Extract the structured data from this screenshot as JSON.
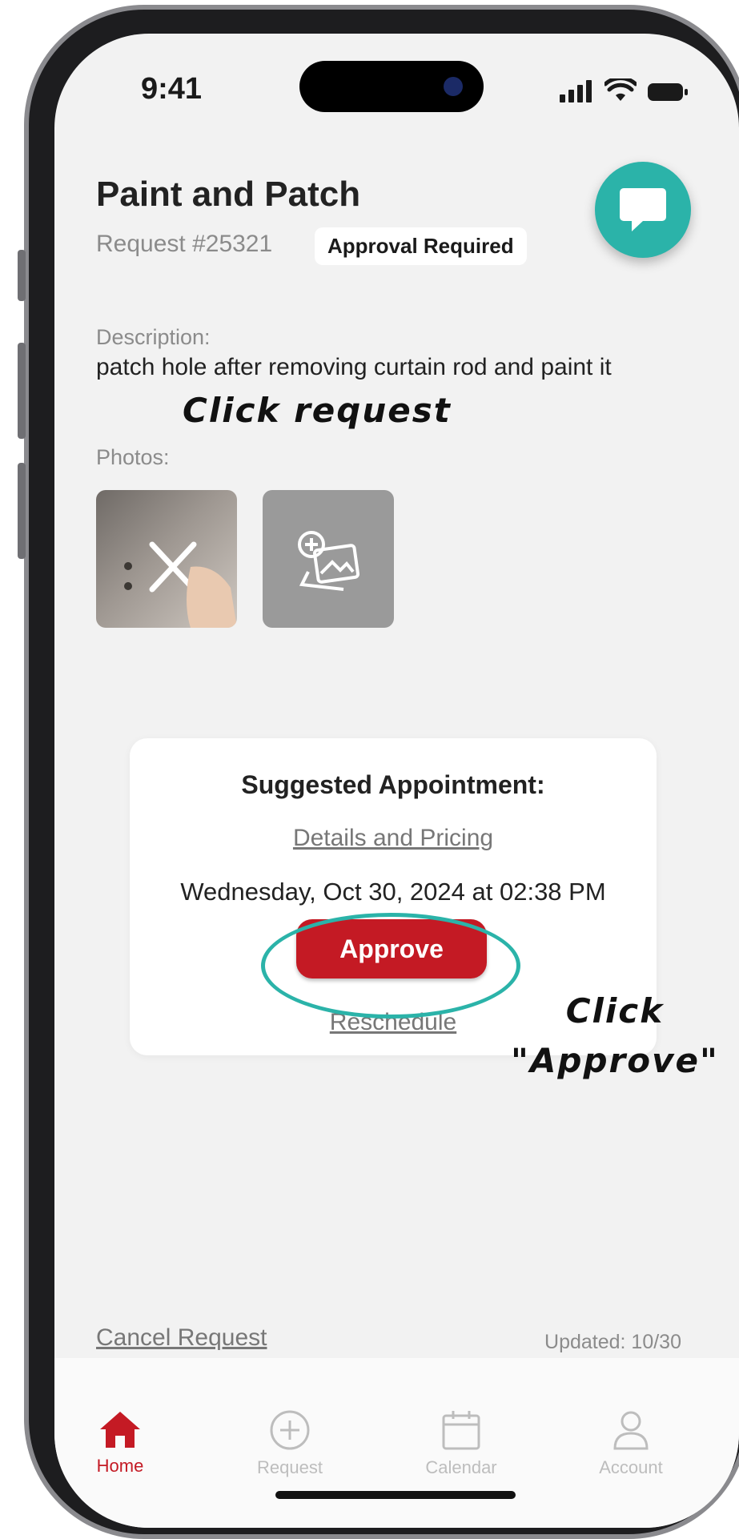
{
  "status_bar": {
    "time": "9:41"
  },
  "request": {
    "title": "Paint and Patch",
    "number": "Request #25321",
    "badge": "Approval Required",
    "description_label": "Description:",
    "description": "patch hole after removing curtain rod and paint it",
    "photos_label": "Photos:"
  },
  "annotations": {
    "click_request": "Click request",
    "click_approve_line1": "Click",
    "click_approve_line2": "\"Approve\""
  },
  "appointment": {
    "title": "Suggested Appointment:",
    "details_link": "Details and Pricing",
    "datetime": "Wednesday, Oct 30, 2024 at 02:38 PM",
    "approve_label": "Approve",
    "reschedule_label": "Reschedule"
  },
  "footer": {
    "cancel_label": "Cancel Request",
    "updated": "Updated: 10/30"
  },
  "tabs": [
    {
      "label": "Home",
      "icon": "home-icon",
      "active": true
    },
    {
      "label": "Request",
      "icon": "plus-circle-icon"
    },
    {
      "label": "Calendar",
      "icon": "calendar-icon"
    },
    {
      "label": "Account",
      "icon": "user-icon"
    }
  ],
  "colors": {
    "accent": "#c41a24",
    "teal": "#2bb3a9",
    "background": "#f2f2f2"
  }
}
